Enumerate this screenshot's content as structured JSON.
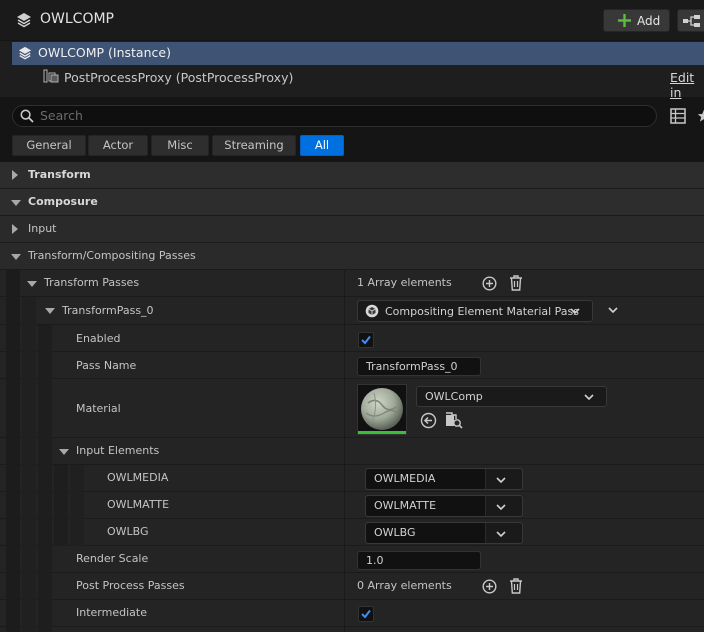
{
  "header": {
    "title": "OWLCOMP",
    "add_label": "Add",
    "title_icon": "layers-icon",
    "blueprint_icon": "blueprint-icon"
  },
  "tree": {
    "instance_label": "OWLCOMP (Instance)",
    "component_label": "PostProcessProxy (PostProcessProxy)",
    "edit_link": "Edit in"
  },
  "search": {
    "placeholder": "Search"
  },
  "filters": [
    "General",
    "Actor",
    "Misc",
    "Streaming",
    "All"
  ],
  "active_filter": "All",
  "categories": {
    "transform": "Transform",
    "composure": "Composure",
    "input": "Input",
    "passes": "Transform/Compositing Passes"
  },
  "props": {
    "transform_passes": {
      "label": "Transform Passes",
      "value": "1 Array elements"
    },
    "transform_pass_0": {
      "label": "TransformPass_0",
      "value": "Compositing Element Material Pass"
    },
    "enabled": {
      "label": "Enabled",
      "checked": true
    },
    "pass_name": {
      "label": "Pass Name",
      "value": "TransformPass_0"
    },
    "material": {
      "label": "Material",
      "value": "OWLComp"
    },
    "input_elements": {
      "label": "Input Elements"
    },
    "inputs": [
      {
        "label": "OWLMEDIA",
        "value": "OWLMEDIA"
      },
      {
        "label": "OWLMATTE",
        "value": "OWLMATTE"
      },
      {
        "label": "OWLBG",
        "value": "OWLBG"
      }
    ],
    "render_scale": {
      "label": "Render Scale",
      "value": "1.0"
    },
    "post_process_passes": {
      "label": "Post Process Passes",
      "value": "0 Array elements"
    },
    "intermediate": {
      "label": "Intermediate",
      "checked": true
    }
  },
  "colors": {
    "accent": "#0070e0",
    "selection": "#3f5374",
    "add_plus": "#5bbf3a",
    "material_underline": "#38c038"
  }
}
